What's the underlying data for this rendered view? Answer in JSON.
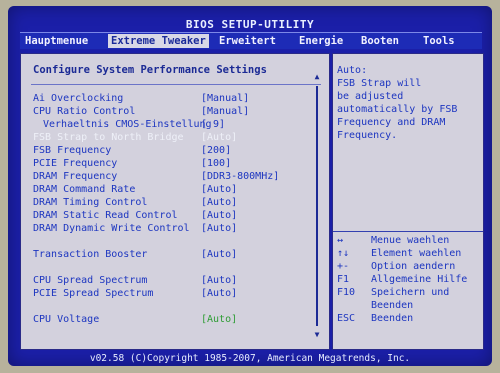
{
  "title": "BIOS SETUP-UTILITY",
  "menu": [
    {
      "label": "Hauptmenue",
      "active": false
    },
    {
      "label": "Extreme Tweaker",
      "active": true
    },
    {
      "label": "Erweitert",
      "active": false
    },
    {
      "label": "Energie",
      "active": false
    },
    {
      "label": "Booten",
      "active": false
    },
    {
      "label": "Tools",
      "active": false
    }
  ],
  "panel": {
    "heading": "Configure System Performance Settings",
    "items": [
      {
        "label": "Ai Overclocking",
        "value": "[Manual]"
      },
      {
        "label": "CPU Ratio Control",
        "value": "[Manual]"
      },
      {
        "label": "Verhaeltnis CMOS-Einstellung",
        "value": "[ 9]"
      },
      {
        "label": "FSB Strap to North Bridge",
        "value": "[Auto]"
      },
      {
        "label": "FSB Frequency",
        "value": "[200]"
      },
      {
        "label": "PCIE Frequency",
        "value": "[100]"
      },
      {
        "label": "DRAM Frequency",
        "value": "[DDR3-800MHz]"
      },
      {
        "label": "DRAM Command Rate",
        "value": "[Auto]"
      },
      {
        "label": "DRAM Timing Control",
        "value": "[Auto]"
      },
      {
        "label": "DRAM Static Read Control",
        "value": "[Auto]"
      },
      {
        "label": "DRAM Dynamic Write Control",
        "value": "[Auto]"
      },
      {
        "label": "Transaction Booster",
        "value": "[Auto]"
      },
      {
        "label": "CPU Spread Spectrum",
        "value": "[Auto]"
      },
      {
        "label": "PCIE Spread Spectrum",
        "value": "[Auto]"
      },
      {
        "label": "CPU Voltage",
        "value": "[Auto]"
      }
    ]
  },
  "help": {
    "lines": [
      "Auto:",
      "FSB Strap will",
      "be adjusted",
      "automatically by FSB",
      "Frequency and DRAM",
      "Frequency."
    ],
    "keys": [
      {
        "key": "↔",
        "desc": "Menue waehlen"
      },
      {
        "key": "↑↓",
        "desc": "Element waehlen"
      },
      {
        "key": "+-",
        "desc": "Option aendern"
      },
      {
        "key": "F1",
        "desc": "Allgemeine Hilfe"
      },
      {
        "key": "F10",
        "desc": "Speichern und"
      },
      {
        "key": "",
        "desc": "Beenden"
      },
      {
        "key": "ESC",
        "desc": "Beenden"
      }
    ]
  },
  "footer": "v02.58 (C)Copyright 1985-2007, American Megatrends, Inc.",
  "colors": {
    "background": "#1b1fa8",
    "panel": "#d3d1dd",
    "text": "#1d36c0",
    "accent": "#2f9d35"
  }
}
